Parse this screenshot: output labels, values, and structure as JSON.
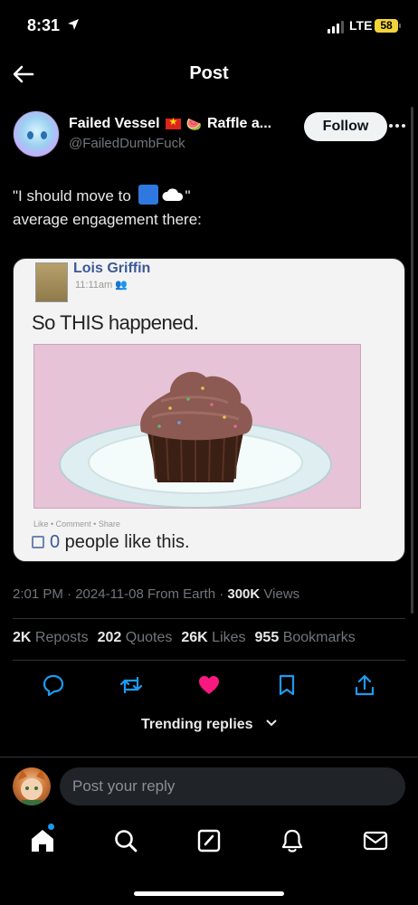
{
  "status_bar": {
    "time": "8:31",
    "network": "LTE",
    "battery": "58"
  },
  "header": {
    "title": "Post"
  },
  "author": {
    "display_name": "Failed Vessel",
    "name_tail": "Raffle a...",
    "handle": "@FailedDumbFuck",
    "follow_label": "Follow"
  },
  "tweet": {
    "line1_prefix": "\"I should move to ",
    "line1_suffix": "\"",
    "line2": "average engagement there:"
  },
  "media": {
    "name": "Lois Griffin",
    "time": "11:11am",
    "status": "So THIS happened.",
    "actions": "Like • Comment • Share",
    "likes_count": "0",
    "likes_text": " people like this."
  },
  "meta": {
    "time": "2:01 PM",
    "date": "2024-11-08",
    "source": "From Earth",
    "views_count": "300K",
    "views_label": "Views"
  },
  "stats": [
    {
      "value": "2K",
      "label": "Reposts"
    },
    {
      "value": "202",
      "label": "Quotes"
    },
    {
      "value": "26K",
      "label": "Likes"
    },
    {
      "value": "955",
      "label": "Bookmarks"
    }
  ],
  "trending": {
    "label": "Trending replies"
  },
  "reply": {
    "placeholder": "Post your reply"
  },
  "icons": {
    "reply": "reply-icon",
    "repost": "repost-icon",
    "like": "heart-icon",
    "bookmark": "bookmark-icon",
    "share": "share-icon",
    "home": "home-icon",
    "search": "search-icon",
    "compose": "compose-icon",
    "notifications": "bell-icon",
    "messages": "mail-icon"
  },
  "colors": {
    "like": "#f91880",
    "accent": "#1d9bf0",
    "battery": "#f2d33a"
  }
}
